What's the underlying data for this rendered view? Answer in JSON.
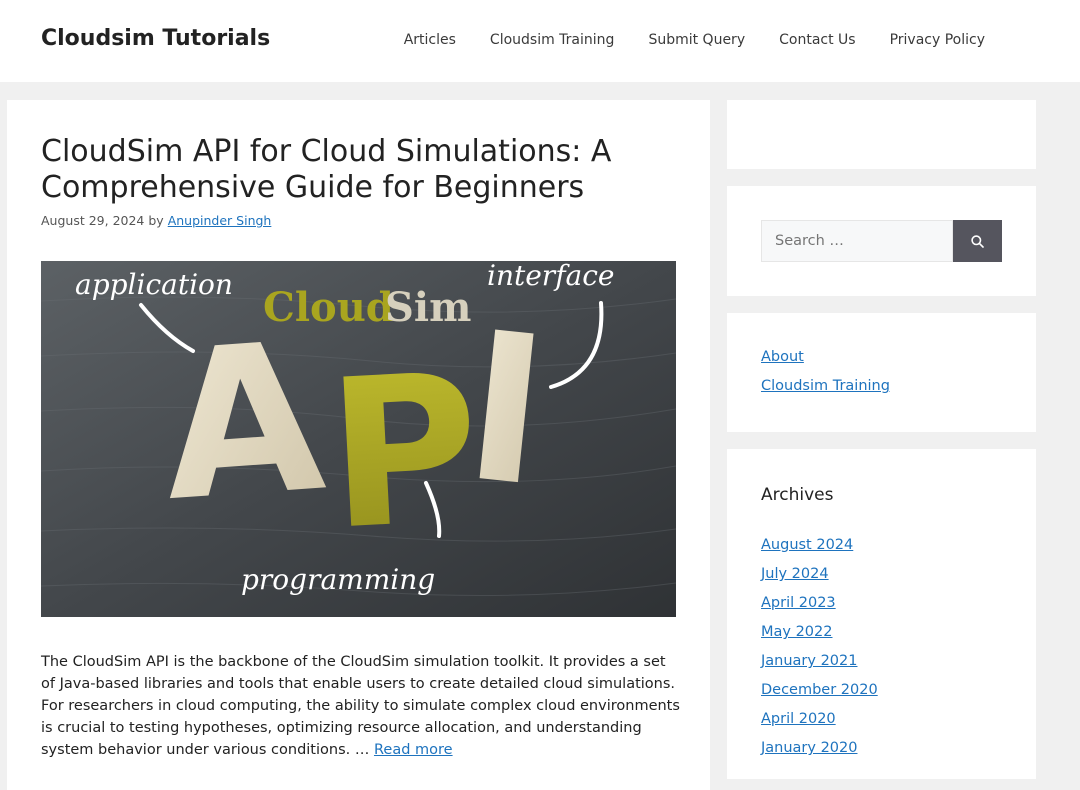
{
  "header": {
    "site_title": "Cloudsim Tutorials",
    "nav": [
      "Articles",
      "Cloudsim Training",
      "Submit Query",
      "Contact Us",
      "Privacy Policy"
    ]
  },
  "post": {
    "title": "CloudSim API for Cloud Simulations: A Comprehensive Guide for Beginners",
    "date": "August 29, 2024",
    "by": "by",
    "author": "Anupinder Singh",
    "image": {
      "word_application": "application",
      "word_interface": "interface",
      "word_programming": "programming",
      "word_cloud": "Cloud",
      "word_sim": "Sim",
      "letters": [
        "A",
        "P",
        "I"
      ]
    },
    "excerpt": "The CloudSim API is the backbone of the CloudSim simulation toolkit. It provides a set of Java-based libraries and tools that enable users to create detailed cloud simulations. For researchers in cloud computing, the ability to simulate complex cloud environments is crucial to testing hypotheses, optimizing resource allocation, and understanding system behavior under various conditions. …",
    "read_more": "Read more"
  },
  "sidebar": {
    "search_placeholder": "Search …",
    "search_icon": "search-icon",
    "pages": [
      "About",
      "Cloudsim Training"
    ],
    "archives_title": "Archives",
    "archives": [
      "August 2024",
      "July 2024",
      "April 2023",
      "May 2022",
      "January 2021",
      "December 2020",
      "April 2020",
      "January 2020"
    ]
  },
  "colors": {
    "link": "#1e73be",
    "search_button": "#55555e",
    "background": "#f0f0f0"
  }
}
